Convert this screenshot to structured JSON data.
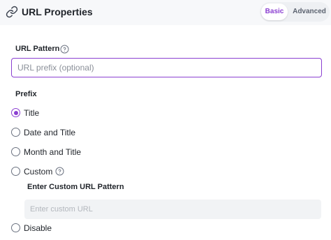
{
  "header": {
    "icon": "link-icon",
    "title": "URL Properties",
    "modes": [
      "Basic",
      "Advanced"
    ],
    "active_mode": "Basic"
  },
  "url_pattern": {
    "label": "URL Pattern",
    "help_icon": "question-circle-icon",
    "placeholder": "URL prefix (optional)",
    "value": ""
  },
  "prefix": {
    "label": "Prefix",
    "options": [
      {
        "label": "Title",
        "selected": true
      },
      {
        "label": "Date and Title",
        "selected": false
      },
      {
        "label": "Month and Title",
        "selected": false
      },
      {
        "label": "Custom",
        "selected": false,
        "help_icon": "question-circle-icon"
      },
      {
        "label": "Disable",
        "selected": false
      }
    ]
  },
  "custom": {
    "label": "Enter Custom URL Pattern",
    "placeholder": "Enter custom URL",
    "value": ""
  },
  "colors": {
    "accent": "#8b3fd1",
    "header_bg": "#f7f8fa",
    "disabled_input_bg": "#f1f3f5"
  }
}
